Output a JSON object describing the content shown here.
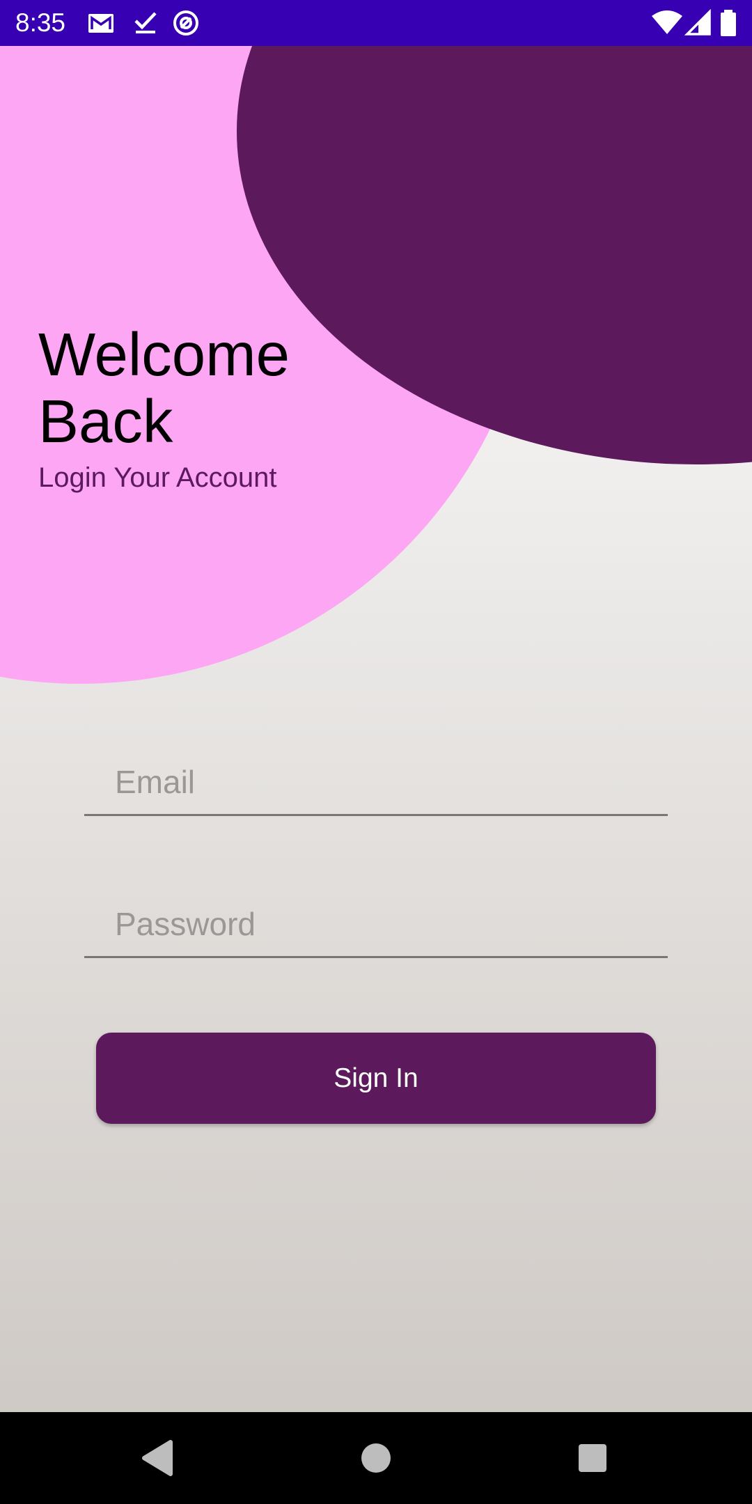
{
  "status_bar": {
    "time": "8:35",
    "background": "#3700b3",
    "left_icons": [
      "gmail-icon",
      "check-icon",
      "at-sign-icon"
    ],
    "right_icons": [
      "wifi-icon",
      "cellular-signal-icon",
      "battery-icon"
    ]
  },
  "header": {
    "title": "Welcome\nBack",
    "subtitle": "Login Your Account"
  },
  "form": {
    "email_placeholder": "Email",
    "password_placeholder": "Password",
    "signin_label": "Sign In"
  },
  "colors": {
    "accent": "#5c1a5d",
    "pink_blob": "#fda6f3",
    "status_bar": "#3700b3"
  },
  "nav_bar": {
    "icons": [
      "back-icon",
      "home-icon",
      "recents-icon"
    ]
  }
}
